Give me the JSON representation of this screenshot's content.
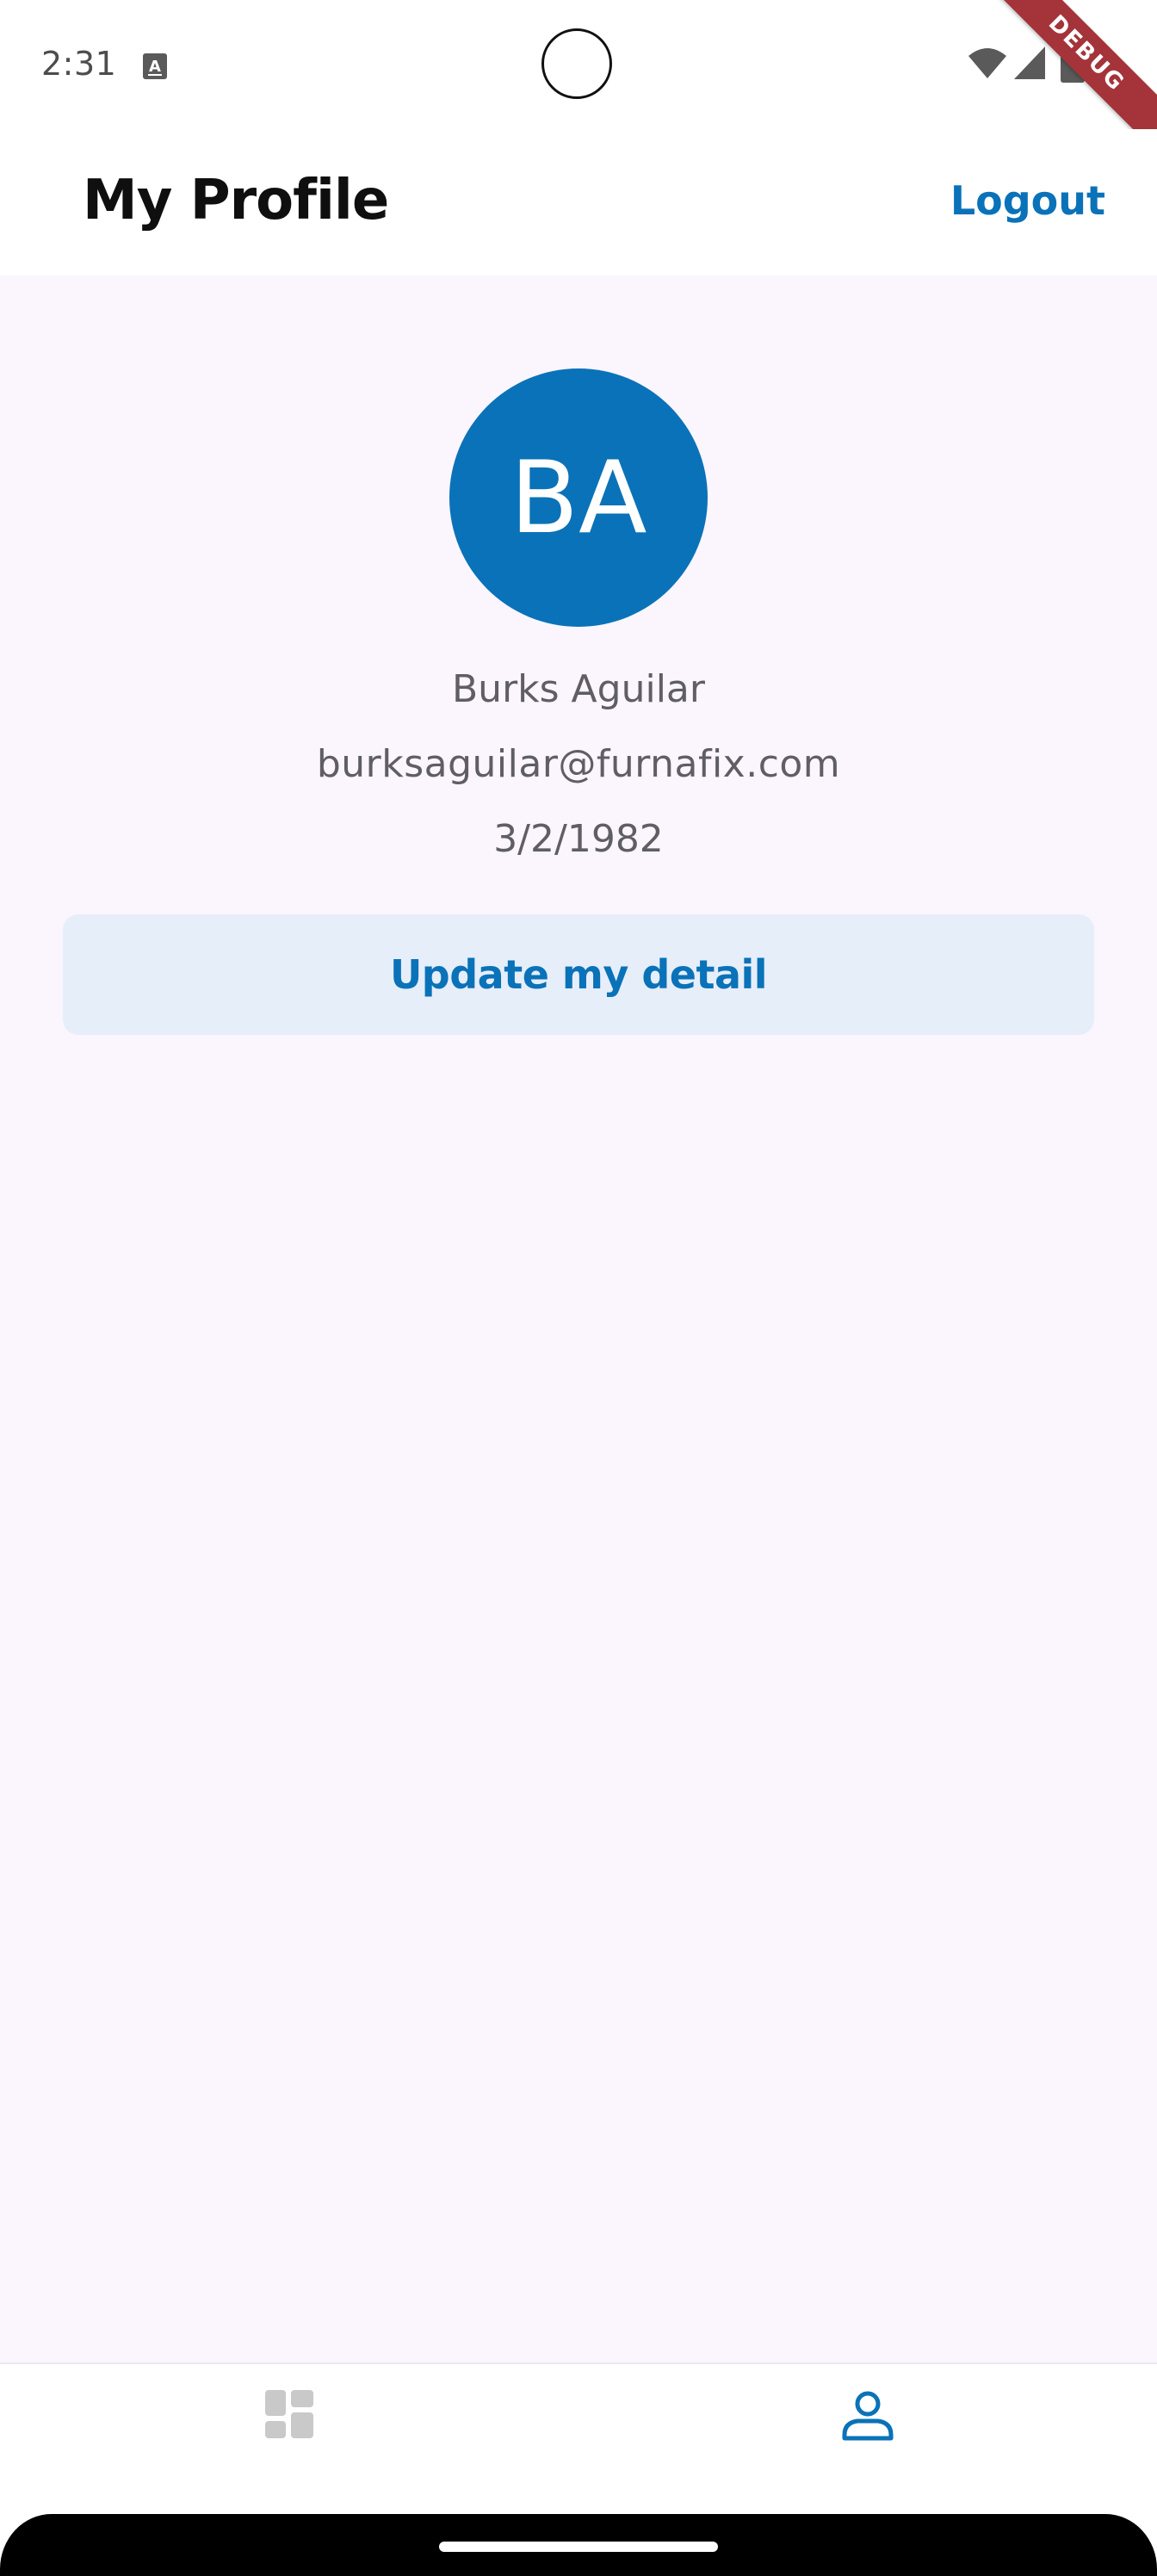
{
  "status_bar": {
    "time": "2:31",
    "debug_label": "DEBUG"
  },
  "app_bar": {
    "title": "My Profile",
    "logout_label": "Logout"
  },
  "profile": {
    "initials": "BA",
    "name": "Burks Aguilar",
    "email": "burksaguilar@furnafix.com",
    "dob": "3/2/1982",
    "update_button_label": "Update my detail"
  },
  "bottom_nav": {
    "items": [
      {
        "icon": "dashboard-icon",
        "active": false
      },
      {
        "icon": "person-icon",
        "active": true
      }
    ]
  },
  "colors": {
    "accent": "#0a72b8",
    "content_background": "#fbf5fd",
    "button_background": "#e6eef9",
    "inactive_icon": "#c9c9c9",
    "debug_ribbon": "#a4343a"
  }
}
